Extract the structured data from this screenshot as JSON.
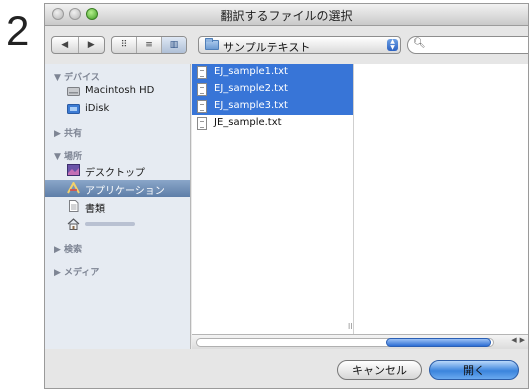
{
  "step_number": "2",
  "window": {
    "title": "翻訳するファイルの選択"
  },
  "toolbar": {
    "nav_back": "◀",
    "nav_forward": "▶",
    "view_icon": "⠿",
    "view_list": "≡",
    "view_column": "▥",
    "location": "サンプルテキスト",
    "search": {
      "value": "",
      "placeholder": ""
    }
  },
  "sidebar": {
    "devices_header": "▼ デバイス",
    "devices": [
      {
        "label": "Macintosh HD",
        "icon": "hard-disk-icon"
      },
      {
        "label": "iDisk",
        "icon": "idisk-icon"
      }
    ],
    "shared_header": "▶ 共有",
    "places_header": "▼ 場所",
    "places": [
      {
        "label": "デスクトップ",
        "icon": "desktop-icon"
      },
      {
        "label": "アプリケーション",
        "icon": "applications-icon",
        "selected": true
      },
      {
        "label": "書類",
        "icon": "documents-icon"
      },
      {
        "label": "",
        "icon": "home-icon"
      }
    ],
    "search_header": "▶ 検索",
    "media_header": "▶ メディア"
  },
  "files": [
    {
      "name": "EJ_sample1.txt",
      "selected": true
    },
    {
      "name": "EJ_sample2.txt",
      "selected": true
    },
    {
      "name": "EJ_sample3.txt",
      "selected": true
    },
    {
      "name": "JE_sample.txt",
      "selected": false
    }
  ],
  "buttons": {
    "cancel": "キャンセル",
    "open": "開く"
  },
  "colors": {
    "selection": "#3875d7",
    "sidebar_selected": "#6b89b3",
    "default_button": "#3b84dd"
  }
}
